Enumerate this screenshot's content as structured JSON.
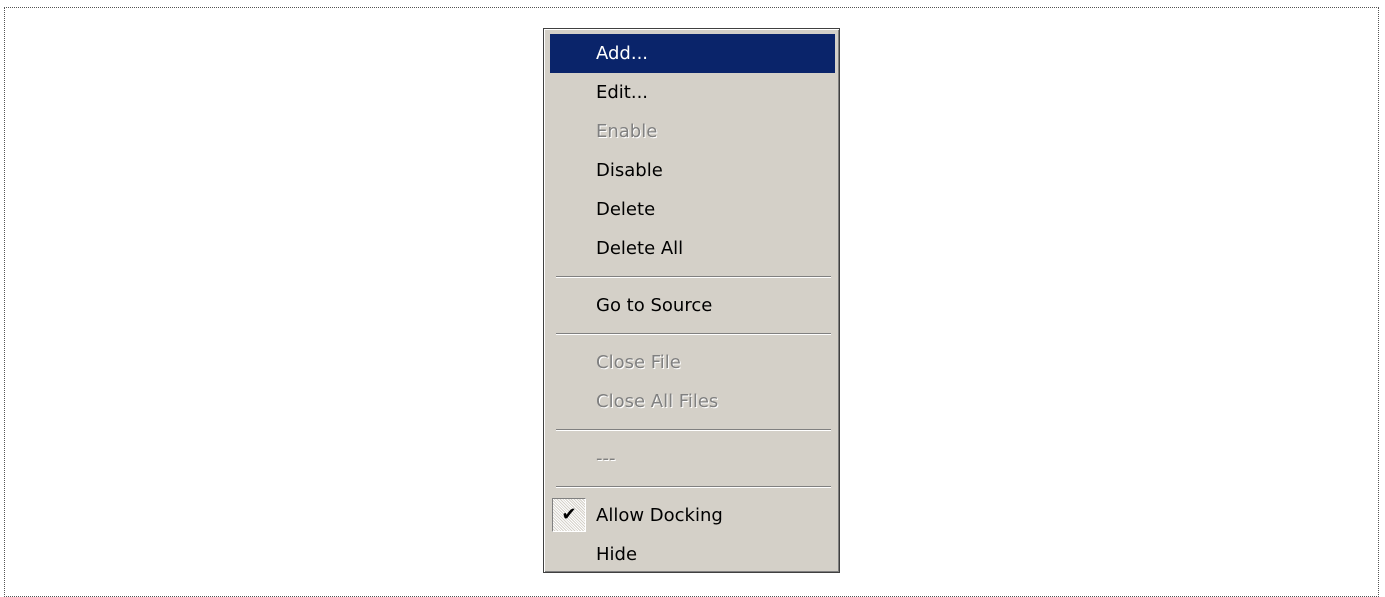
{
  "menu": {
    "items": [
      {
        "label": "Add...",
        "state": "selected"
      },
      {
        "label": "Edit...",
        "state": "enabled"
      },
      {
        "label": "Enable",
        "state": "disabled"
      },
      {
        "label": "Disable",
        "state": "enabled"
      },
      {
        "label": "Delete",
        "state": "enabled"
      },
      {
        "label": "Delete All",
        "state": "enabled"
      },
      {
        "label": "Go to Source",
        "state": "enabled"
      },
      {
        "label": "Close File",
        "state": "disabled"
      },
      {
        "label": "Close All Files",
        "state": "disabled"
      },
      {
        "label": "---",
        "state": "disabled"
      },
      {
        "label": "Allow Docking",
        "state": "checked",
        "check_glyph": "✔",
        "icon": "checkmark-icon"
      },
      {
        "label": "Hide",
        "state": "enabled"
      }
    ]
  },
  "colors": {
    "menu_bg": "#d4d0c8",
    "highlight": "#0a246a",
    "disabled_text": "#808080"
  }
}
